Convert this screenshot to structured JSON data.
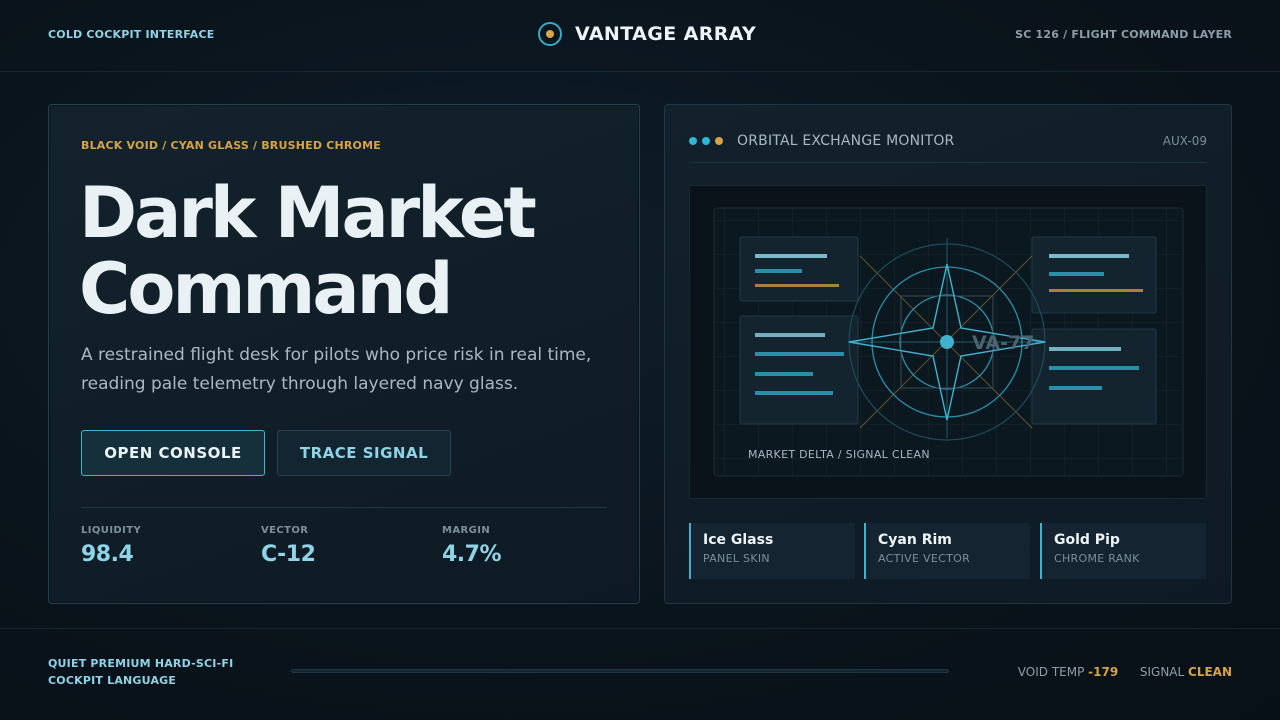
{
  "header": {
    "left_text": "COLD COCKPIT INTERFACE",
    "brand_title": "VANTAGE ARRAY",
    "right_text": "SC 126 / FLIGHT COMMAND LAYER"
  },
  "hero": {
    "eyebrow": "BLACK VOID / CYAN GLASS / BRUSHED CHROME",
    "title_line1": "Dark Market",
    "title_line2": "Command",
    "description": "A restrained flight desk for pilots who price risk in real time, reading pale telemetry through layered navy glass.",
    "primary_button": "OPEN CONSOLE",
    "secondary_button": "TRACE SIGNAL"
  },
  "stats": [
    {
      "label": "LIQUIDITY",
      "value": "98.4"
    },
    {
      "label": "VECTOR",
      "value": "C-12"
    },
    {
      "label": "MARGIN",
      "value": "4.7%"
    }
  ],
  "monitor": {
    "title": "ORBITAL EXCHANGE MONITOR",
    "code": "AUX-09",
    "screen_label": "VA-77",
    "caption": "MARKET DELTA / SIGNAL CLEAN",
    "dot_colors": [
      "#2fb6d6",
      "#2fb6d6",
      "#d6a446"
    ]
  },
  "cards": [
    {
      "title": "Ice Glass",
      "subtitle": "PANEL SKIN"
    },
    {
      "title": "Cyan Rim",
      "subtitle": "ACTIVE VECTOR"
    },
    {
      "title": "Gold Pip",
      "subtitle": "CHROME RANK"
    }
  ],
  "footer": {
    "left_line1": "QUIET PREMIUM HARD-SCI-FI",
    "left_line2": "COCKPIT LANGUAGE",
    "void_temp_label": "VOID TEMP",
    "void_temp_value": "-179",
    "signal_label": "SIGNAL",
    "signal_value": "CLEAN"
  },
  "colors": {
    "accent_cyan": "#3fb2cf",
    "accent_gold": "#d6a446",
    "background": "#0a141c"
  }
}
